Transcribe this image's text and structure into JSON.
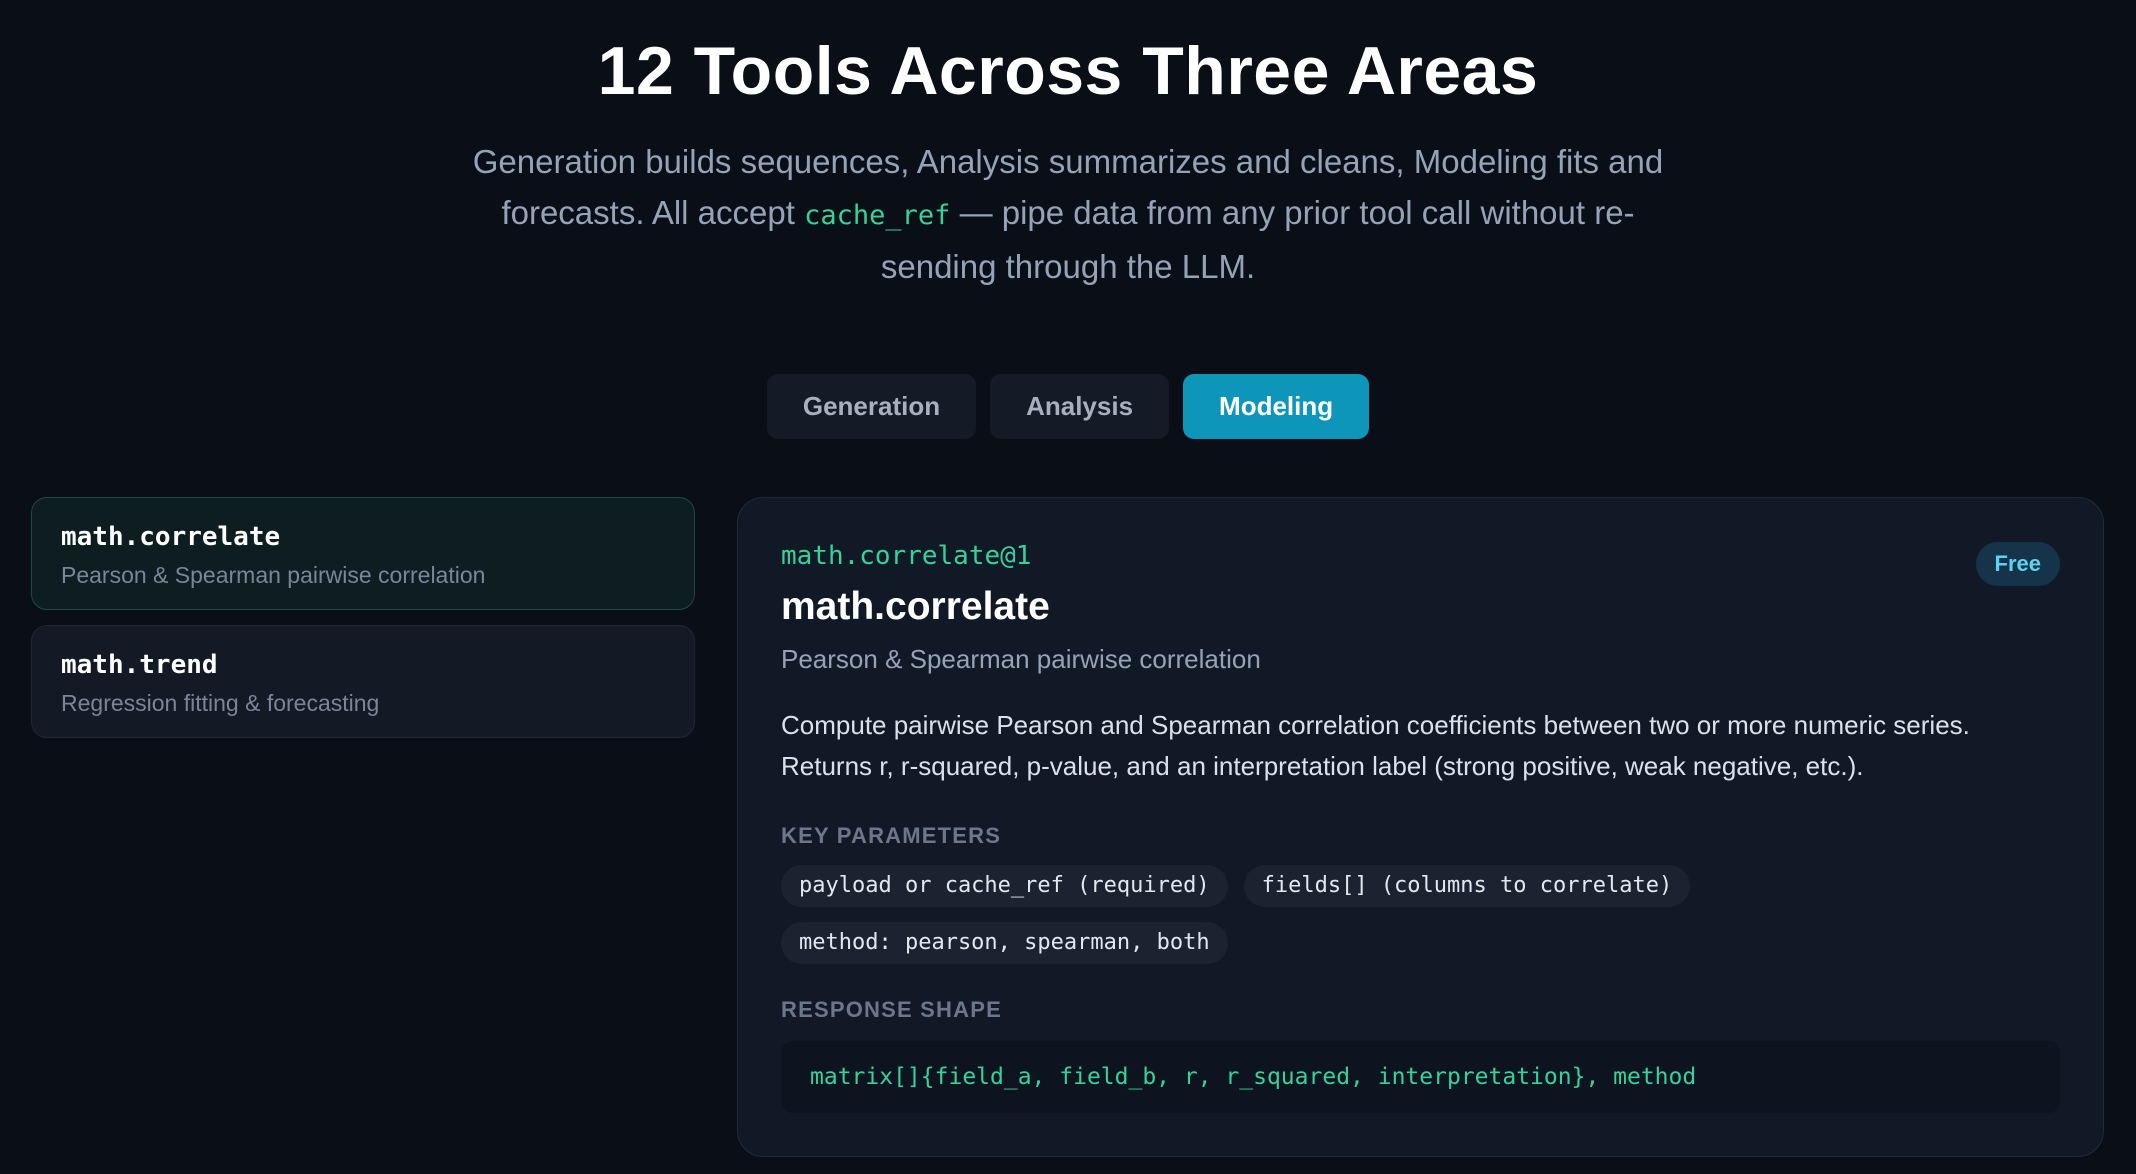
{
  "header": {
    "title": "12 Tools Across Three Areas",
    "subtitle_part1": "Generation builds sequences, Analysis summarizes and cleans, Modeling fits and forecasts. All accept",
    "subtitle_code": "cache_ref",
    "subtitle_part2": "— pipe data from any prior tool call without re-sending through the LLM."
  },
  "tabs": [
    {
      "label": "Generation",
      "active": false
    },
    {
      "label": "Analysis",
      "active": false
    },
    {
      "label": "Modeling",
      "active": true
    }
  ],
  "tools": [
    {
      "name": "math.correlate",
      "desc": "Pearson & Spearman pairwise correlation",
      "active": true
    },
    {
      "name": "math.trend",
      "desc": "Regression fitting & forecasting",
      "active": false
    }
  ],
  "detail": {
    "version": "math.correlate@1",
    "badge": "Free",
    "title": "math.correlate",
    "subtitle": "Pearson & Spearman pairwise correlation",
    "body": "Compute pairwise Pearson and Spearman correlation coefficients between two or more numeric series. Returns r, r-squared, p-value, and an interpretation label (strong positive, weak negative, etc.).",
    "params_label": "KEY PARAMETERS",
    "params": [
      "payload or cache_ref (required)",
      "fields[] (columns to correlate)",
      "method: pearson, spearman, both"
    ],
    "response_label": "RESPONSE SHAPE",
    "response": "matrix[]{field_a, field_b, r, r_squared, interpretation}, method"
  },
  "colors": {
    "background": "#0a0e17",
    "accent": "#0e95ba",
    "code_green": "#34d399",
    "badge_text": "#5ed3f0"
  }
}
